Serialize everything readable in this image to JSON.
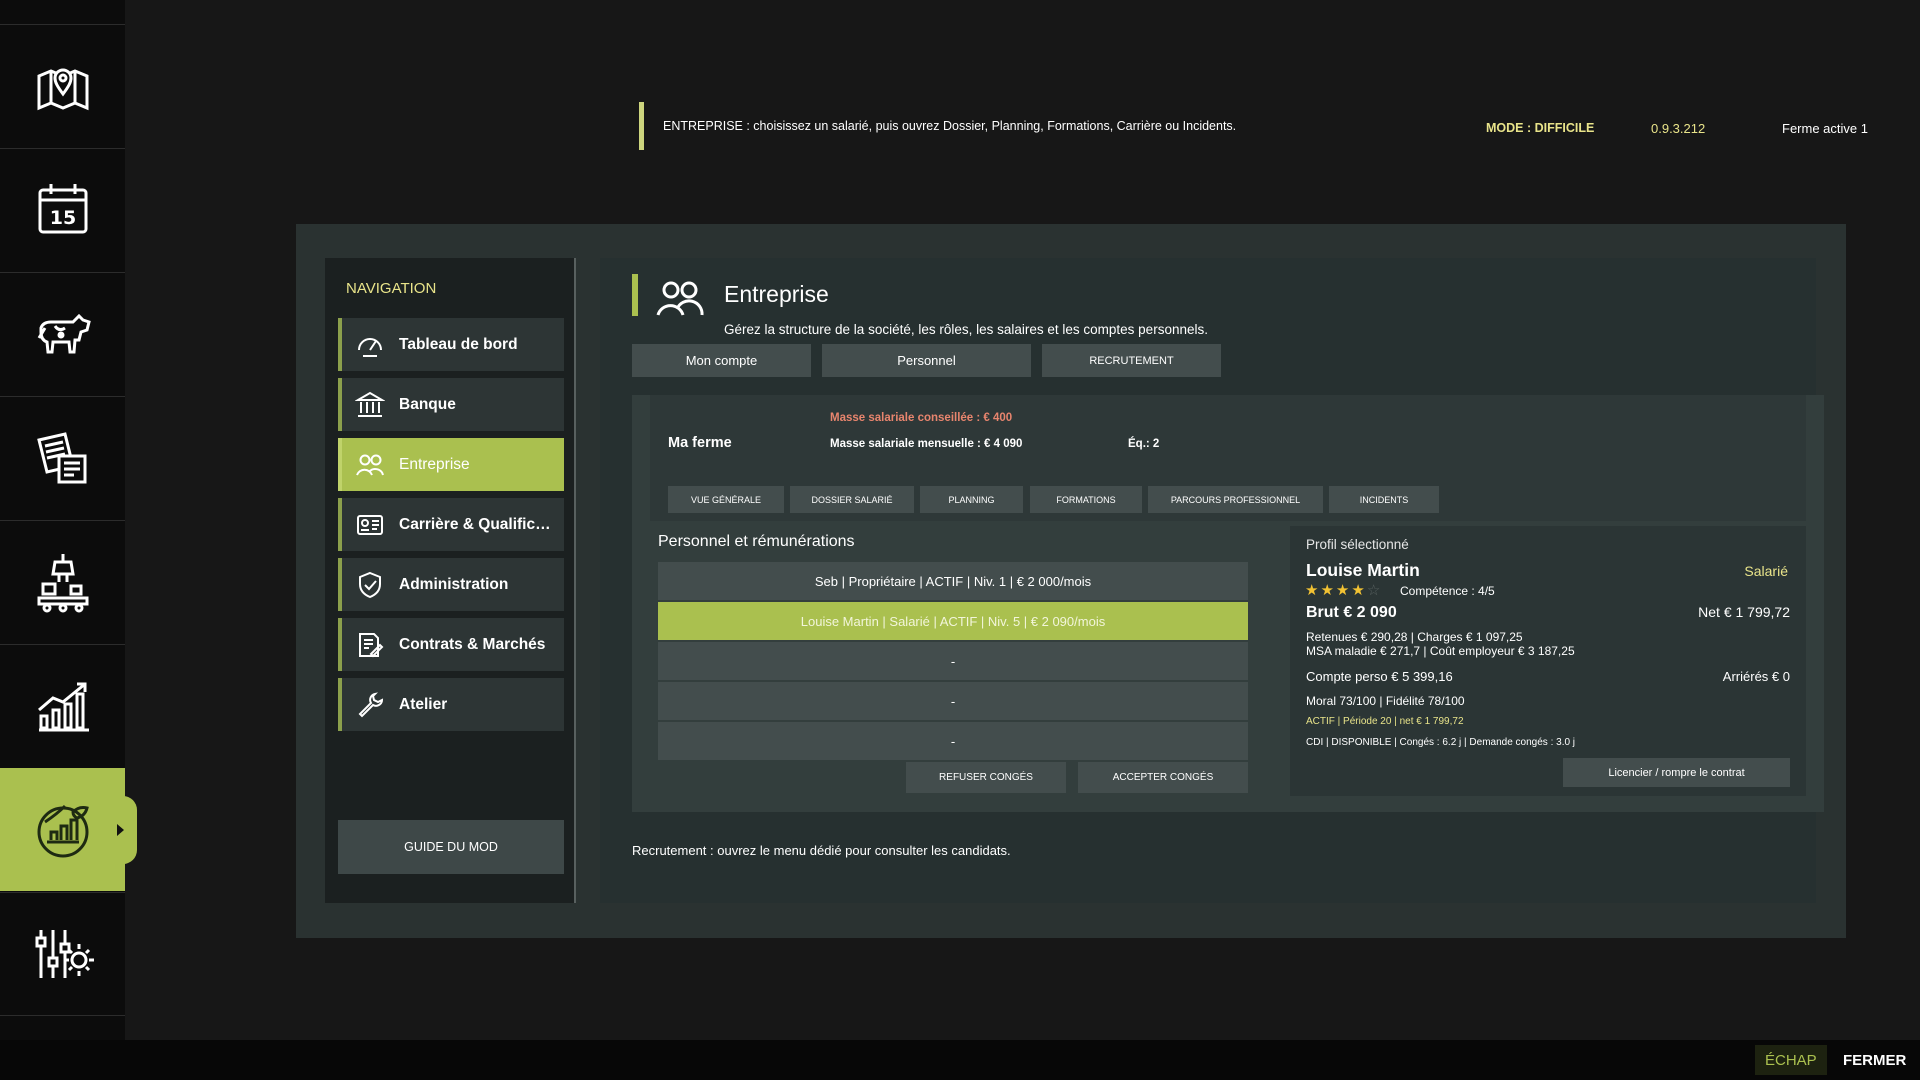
{
  "rail": {
    "items": [
      {
        "icon": "map-pin-icon"
      },
      {
        "icon": "calendar-icon",
        "text": "15"
      },
      {
        "icon": "cow-icon"
      },
      {
        "icon": "documents-icon"
      },
      {
        "icon": "factory-icon"
      },
      {
        "icon": "stats-chart-icon"
      },
      {
        "icon": "farm-mod-icon",
        "active": true
      },
      {
        "icon": "settings-sliders-icon"
      }
    ]
  },
  "topbar": {
    "hint": "ENTREPRISE : choisissez un salarié, puis ouvrez Dossier, Planning, Formations, Carrière ou Incidents.",
    "mode": "MODE : DIFFICILE",
    "version": "0.9.3.212",
    "farm": "Ferme active 1"
  },
  "nav": {
    "title": "NAVIGATION",
    "items": [
      {
        "label": "Tableau de bord",
        "icon": "dashboard-gauge-icon"
      },
      {
        "label": "Banque",
        "icon": "bank-icon"
      },
      {
        "label": "Entreprise",
        "icon": "people-icon",
        "active": true
      },
      {
        "label": "Carrière & Qualifications",
        "icon": "id-card-icon"
      },
      {
        "label": "Administration",
        "icon": "shield-check-icon"
      },
      {
        "label": "Contrats & Marchés",
        "icon": "contract-icon"
      },
      {
        "label": "Atelier",
        "icon": "wrench-icon"
      }
    ],
    "guide": "GUIDE DU MOD"
  },
  "page": {
    "title": "Entreprise",
    "subtitle": "Gérez la structure de la société, les rôles, les salaires et les comptes personnels.",
    "tabs": [
      "Mon compte",
      "Personnel",
      "RECRUTEMENT"
    ]
  },
  "farm": {
    "name": "Ma ferme",
    "mass_advised": "Masse salariale conseillée : € 400",
    "mass_monthly": "Masse salariale mensuelle : € 4 090",
    "eq": "Éq.: 2",
    "subtabs": [
      "VUE GÉNÉRALE",
      "DOSSIER SALARIÉ",
      "PLANNING",
      "FORMATIONS",
      "PARCOURS PROFESSIONNEL",
      "INCIDENTS"
    ]
  },
  "staff": {
    "title": "Personnel et rémunérations",
    "rows": [
      "Seb | Propriétaire | ACTIF | Niv. 1 | € 2 000/mois",
      "Louise Martin | Salarié | ACTIF | Niv. 5 | € 2 090/mois",
      "-",
      "-",
      "-"
    ],
    "selected_index": 1,
    "refuse": "REFUSER CONGÉS",
    "accept": "ACCEPTER CONGÉS"
  },
  "profile": {
    "label": "Profil sélectionné",
    "name": "Louise Martin",
    "role": "Salarié",
    "stars": 4,
    "stars_max": 5,
    "competence": "Compétence : 4/5",
    "brut": "Brut € 2 090",
    "net": "Net € 1 799,72",
    "retenues": "Retenues € 290,28 | Charges € 1 097,25",
    "msa": "MSA maladie € 271,7 | Coût employeur € 3 187,25",
    "compte": "Compte perso € 5 399,16",
    "arrieres": "Arriérés € 0",
    "moral": "Moral 73/100 | Fidélité 78/100",
    "actif": "ACTIF | Période 20 | net € 1 799,72",
    "cdi": "CDI | DISPONIBLE | Congés : 6.2 j | Demande congés : 3.0 j",
    "fire": "Licencier / rompre le contrat"
  },
  "recruit_note": "Recrutement : ouvrez le menu dédié pour consulter les candidats.",
  "bottom": {
    "esc": "ÉCHAP",
    "close": "FERMER"
  },
  "colors": {
    "accent": "#aac04f",
    "highlight_text": "#e9e48a",
    "warning": "#e8856e",
    "star": "#f2c233"
  }
}
